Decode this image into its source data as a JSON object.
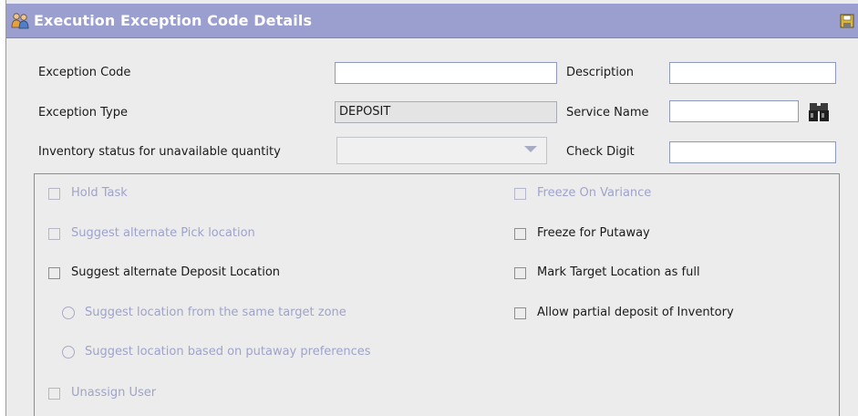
{
  "header": {
    "title": "Execution Exception Code Details"
  },
  "form": {
    "exception_code_label": "Exception Code",
    "exception_code_value": "",
    "description_label": "Description",
    "description_value": "",
    "exception_type_label": "Exception Type",
    "exception_type_value": "DEPOSIT",
    "service_name_label": "Service Name",
    "service_name_value": "",
    "inventory_status_label": "Inventory status for unavailable quantity",
    "inventory_status_value": "",
    "check_digit_label": "Check Digit",
    "check_digit_value": ""
  },
  "options": {
    "hold_task": "Hold Task",
    "suggest_alt_pick": "Suggest alternate Pick location",
    "suggest_alt_deposit": "Suggest alternate Deposit Location",
    "suggest_same_zone": "Suggest location from the same target zone",
    "suggest_putaway_prefs": "Suggest location based on putaway preferences",
    "unassign_user": "Unassign User",
    "freeze_on_variance": "Freeze On Variance",
    "freeze_for_putaway": "Freeze for Putaway",
    "mark_target_full": "Mark Target Location as full",
    "allow_partial_deposit": "Allow partial deposit of Inventory"
  },
  "icons": {
    "title": "users-icon",
    "save": "save-icon",
    "lookup": "binoculars-icon"
  },
  "colors": {
    "titlebar": "#9a9fcf",
    "disabled_text": "#9ea3cc",
    "field_border": "#8e9abd"
  }
}
